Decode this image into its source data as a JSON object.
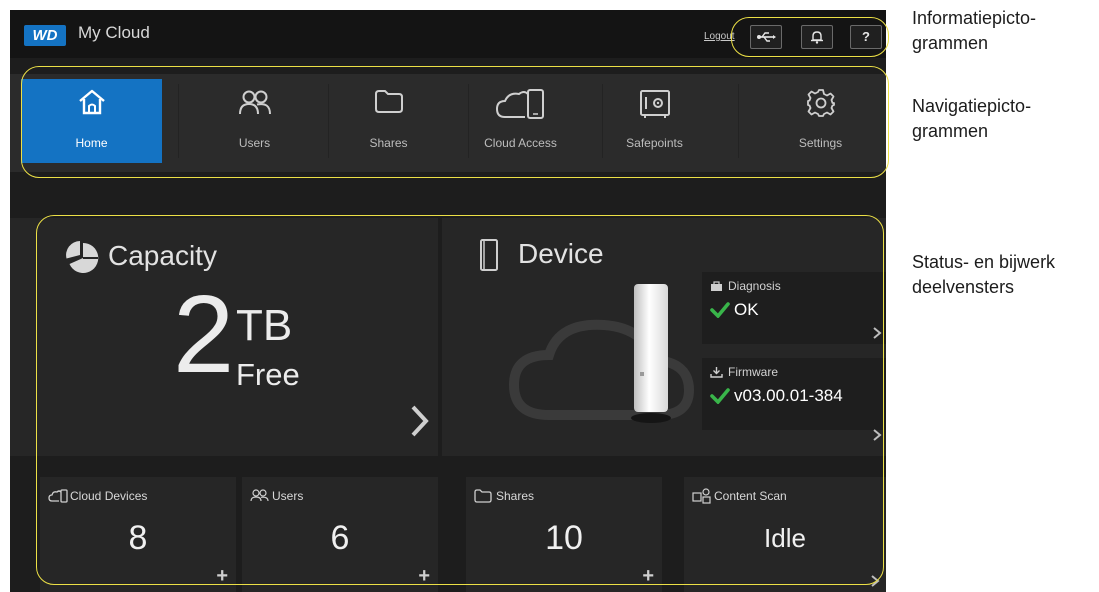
{
  "header": {
    "logo": "WD",
    "title": "My Cloud",
    "logout": "Logout",
    "icons": [
      "usb-icon",
      "bell-icon",
      "help-icon"
    ],
    "help_label": "?"
  },
  "nav": {
    "items": [
      {
        "label": "Home",
        "icon": "home-icon",
        "active": true
      },
      {
        "label": "Users",
        "icon": "users-icon"
      },
      {
        "label": "Shares",
        "icon": "folder-icon"
      },
      {
        "label": "Cloud Access",
        "icon": "cloud-device-icon"
      },
      {
        "label": "Safepoints",
        "icon": "safe-icon"
      },
      {
        "label": "Settings",
        "icon": "gear-icon"
      }
    ]
  },
  "capacity": {
    "title": "Capacity",
    "value": "2",
    "unit": "TB",
    "suffix": "Free"
  },
  "device": {
    "title": "Device",
    "diagnosis": {
      "label": "Diagnosis",
      "value": "OK"
    },
    "firmware": {
      "label": "Firmware",
      "value": "v03.00.01-384"
    }
  },
  "tiles": [
    {
      "label": "Cloud Devices",
      "value": "8"
    },
    {
      "label": "Users",
      "value": "6"
    },
    {
      "label": "Shares",
      "value": "10"
    },
    {
      "label": "Content Scan",
      "value": "Idle"
    }
  ],
  "annotations": {
    "info": [
      "Informatiepicto-",
      "grammen"
    ],
    "nav": [
      "Navigatiepicto-",
      "grammen"
    ],
    "status": [
      "Status- en bijwerk",
      "deelvensters"
    ]
  },
  "colors": {
    "accent": "#1473c3",
    "check": "#39b54a",
    "callout": "#ece046",
    "background": "#1d1d1d"
  }
}
